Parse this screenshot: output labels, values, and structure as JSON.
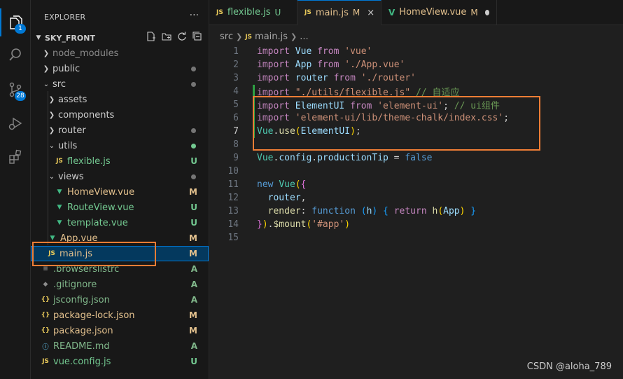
{
  "activity": {
    "badges": {
      "explorer": "1",
      "source_control": "28"
    }
  },
  "sidebar": {
    "title": "EXPLORER",
    "more": "···",
    "folder": "SKY_FRONT",
    "items": [
      {
        "label": "node_modules"
      },
      {
        "label": "public"
      },
      {
        "label": "src"
      },
      {
        "label": "assets"
      },
      {
        "label": "components"
      },
      {
        "label": "router"
      },
      {
        "label": "utils"
      },
      {
        "label": "flexible.js",
        "status": "U"
      },
      {
        "label": "views"
      },
      {
        "label": "HomeView.vue",
        "status": "M"
      },
      {
        "label": "RouteView.vue",
        "status": "U"
      },
      {
        "label": "template.vue",
        "status": "U"
      },
      {
        "label": "App.vue",
        "status": "M"
      },
      {
        "label": "main.js",
        "status": "M"
      },
      {
        "label": ".browserslistrc",
        "status": "A"
      },
      {
        "label": ".gitignore",
        "status": "A"
      },
      {
        "label": "jsconfig.json",
        "status": "A"
      },
      {
        "label": "package-lock.json",
        "status": "M"
      },
      {
        "label": "package.json",
        "status": "M"
      },
      {
        "label": "README.md",
        "status": "A"
      },
      {
        "label": "vue.config.js",
        "status": "U"
      }
    ]
  },
  "tabs": [
    {
      "icon": "JS",
      "label": "flexible.js",
      "status": "U"
    },
    {
      "icon": "JS",
      "label": "main.js",
      "status": "M",
      "close": "×"
    },
    {
      "icon": "V",
      "label": "HomeView.vue",
      "status": "M"
    }
  ],
  "breadcrumb": {
    "folder": "src",
    "icon": "JS",
    "file": "main.js",
    "more": "..."
  },
  "editor": {
    "line_numbers": [
      "1",
      "2",
      "3",
      "4",
      "5",
      "6",
      "7",
      "8",
      "9",
      "10",
      "11",
      "12",
      "13",
      "14",
      "15"
    ],
    "current_line": "7"
  },
  "watermark": "CSDN @aloha_789",
  "colors": {
    "accent": "#0078d4",
    "highlight": "#ef7d35",
    "modified": "#e2c08d",
    "untracked": "#73c991",
    "added": "#81b88b"
  }
}
